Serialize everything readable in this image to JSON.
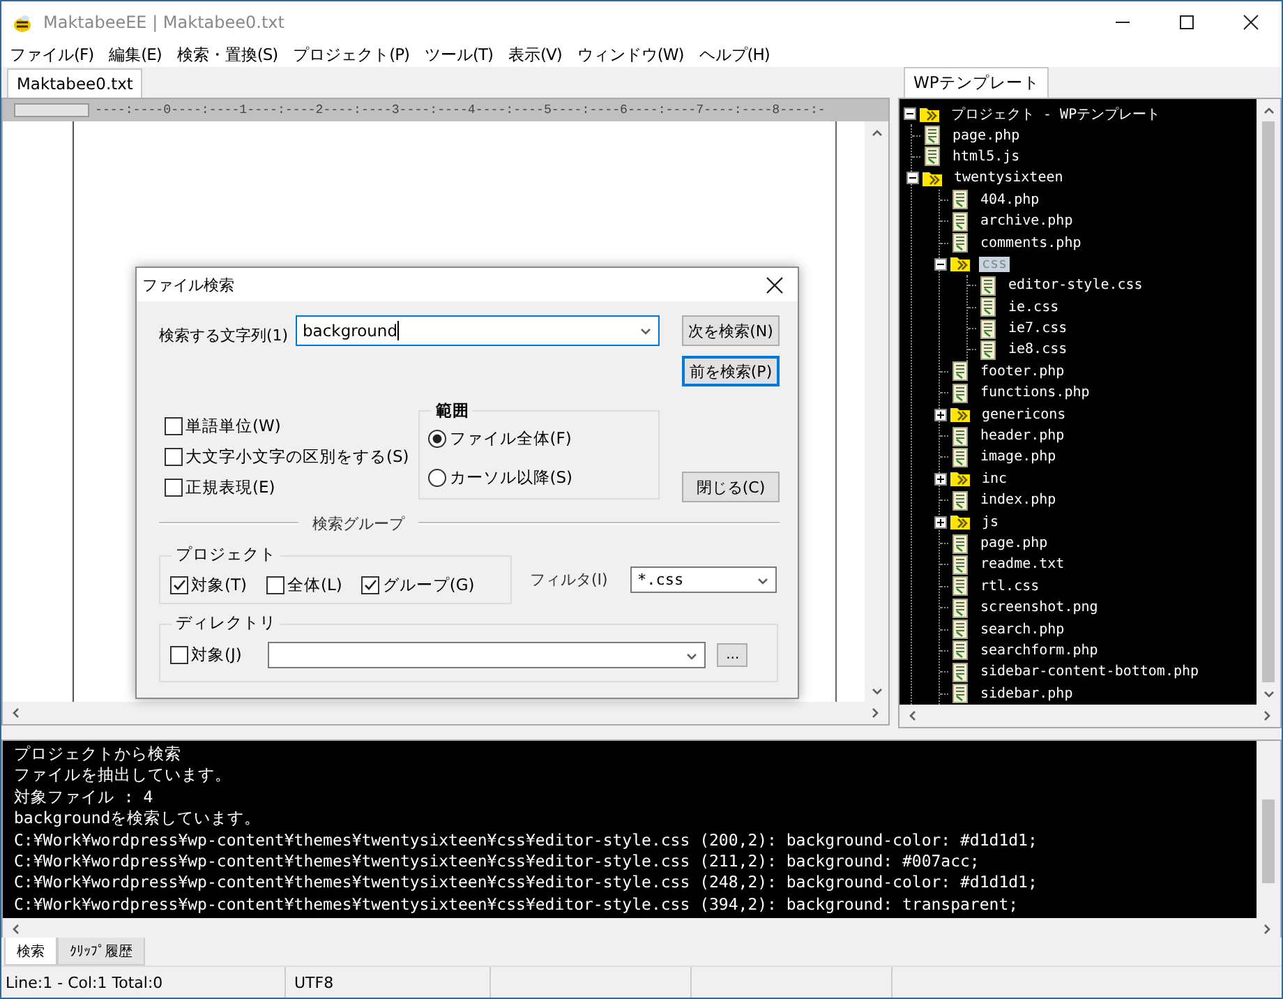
{
  "window": {
    "title": "MaktabeeEE | Maktabee0.txt"
  },
  "menu": [
    "ファイル(F)",
    "編集(E)",
    "検索・置換(S)",
    "プロジェクト(P)",
    "ツール(T)",
    "表示(V)",
    "ウィンドウ(W)",
    "ヘルプ(H)"
  ],
  "editor": {
    "tabs": [
      {
        "label": "Maktabee0.txt",
        "selected": true
      }
    ],
    "ruler": "----:----0----:----1----:----2----:----3----:----4----:----5----:----6----:----7----:----8----:-"
  },
  "project_panel": {
    "tabs": [
      {
        "label": "WPテンプレート",
        "selected": true
      }
    ],
    "tree": [
      {
        "kind": "folder",
        "label": "プロジェクト - WPテンプレート",
        "expanded": true,
        "selected": false,
        "children": [
          {
            "kind": "file",
            "label": "page.php",
            "selected": false
          },
          {
            "kind": "file",
            "label": "html5.js",
            "selected": false
          },
          {
            "kind": "folder",
            "label": "twentysixteen",
            "expanded": true,
            "selected": false,
            "children": [
              {
                "kind": "file",
                "label": "404.php",
                "selected": false
              },
              {
                "kind": "file",
                "label": "archive.php",
                "selected": false
              },
              {
                "kind": "file",
                "label": "comments.php",
                "selected": false
              },
              {
                "kind": "folder",
                "label": "css",
                "expanded": true,
                "selected": true,
                "children": [
                  {
                    "kind": "file",
                    "label": "editor-style.css",
                    "selected": false
                  },
                  {
                    "kind": "file",
                    "label": "ie.css",
                    "selected": false
                  },
                  {
                    "kind": "file",
                    "label": "ie7.css",
                    "selected": false
                  },
                  {
                    "kind": "file",
                    "label": "ie8.css",
                    "selected": false
                  }
                ]
              },
              {
                "kind": "file",
                "label": "footer.php",
                "selected": false
              },
              {
                "kind": "file",
                "label": "functions.php",
                "selected": false
              },
              {
                "kind": "folder",
                "label": "genericons",
                "expanded": false,
                "selected": false
              },
              {
                "kind": "file",
                "label": "header.php",
                "selected": false
              },
              {
                "kind": "file",
                "label": "image.php",
                "selected": false
              },
              {
                "kind": "folder",
                "label": "inc",
                "expanded": false,
                "selected": false
              },
              {
                "kind": "file",
                "label": "index.php",
                "selected": false
              },
              {
                "kind": "folder",
                "label": "js",
                "expanded": false,
                "selected": false
              },
              {
                "kind": "file",
                "label": "page.php",
                "selected": false
              },
              {
                "kind": "file",
                "label": "readme.txt",
                "selected": false
              },
              {
                "kind": "file",
                "label": "rtl.css",
                "selected": false
              },
              {
                "kind": "file",
                "label": "screenshot.png",
                "selected": false
              },
              {
                "kind": "file",
                "label": "search.php",
                "selected": false
              },
              {
                "kind": "file",
                "label": "searchform.php",
                "selected": false
              },
              {
                "kind": "file",
                "label": "sidebar-content-bottom.php",
                "selected": false
              },
              {
                "kind": "file",
                "label": "sidebar.php",
                "selected": false
              }
            ]
          }
        ]
      }
    ]
  },
  "dialog": {
    "title": "ファイル検索",
    "search_label": "検索する文字列(1)",
    "search_value": "background",
    "buttons": [
      {
        "label": "次を検索(N)",
        "focused": false
      },
      {
        "label": "前を検索(P)",
        "focused": true
      }
    ],
    "close_button": "閉じる(C)",
    "options": [
      {
        "label": "単語単位(W)",
        "checked": false
      },
      {
        "label": "大文字小文字の区別をする(S)",
        "checked": false
      },
      {
        "label": "正規表現(E)",
        "checked": false
      }
    ],
    "scope": {
      "title": "範囲",
      "options": [
        {
          "label": "ファイル全体(F)",
          "selected": true
        },
        {
          "label": "カーソル以降(S)",
          "selected": false
        }
      ]
    },
    "search_group_label": "検索グループ",
    "project_group": {
      "title": "プロジェクト",
      "options": [
        {
          "label": "対象(T)",
          "checked": true
        },
        {
          "label": "全体(L)",
          "checked": false
        },
        {
          "label": "グループ(G)",
          "checked": true
        }
      ]
    },
    "filter_label": "フィルタ(I)",
    "filter_value": "*.css",
    "directory_group": {
      "title": "ディレクトリ",
      "options": [
        {
          "label": "対象(J)",
          "checked": false
        }
      ],
      "browse_button": "..."
    }
  },
  "output": {
    "lines": [
      "プロジェクトから検索",
      "ファイルを抽出しています。",
      "対象ファイル : 4",
      "backgroundを検索しています。",
      "C:¥Work¥wordpress¥wp-content¥themes¥twentysixteen¥css¥editor-style.css (200,2): background-color: #d1d1d1;",
      "C:¥Work¥wordpress¥wp-content¥themes¥twentysixteen¥css¥editor-style.css (211,2): background: #007acc;",
      "C:¥Work¥wordpress¥wp-content¥themes¥twentysixteen¥css¥editor-style.css (248,2): background-color: #d1d1d1;",
      "C:¥Work¥wordpress¥wp-content¥themes¥twentysixteen¥css¥editor-style.css (394,2): background: transparent;"
    ]
  },
  "bottom_tabs": [
    {
      "label": "検索",
      "selected": true
    },
    {
      "label": "ｸﾘｯﾌﾟ履歴",
      "selected": false
    }
  ],
  "status_bar": [
    "Line:1 - Col:1 Total:0",
    "UTF8"
  ]
}
